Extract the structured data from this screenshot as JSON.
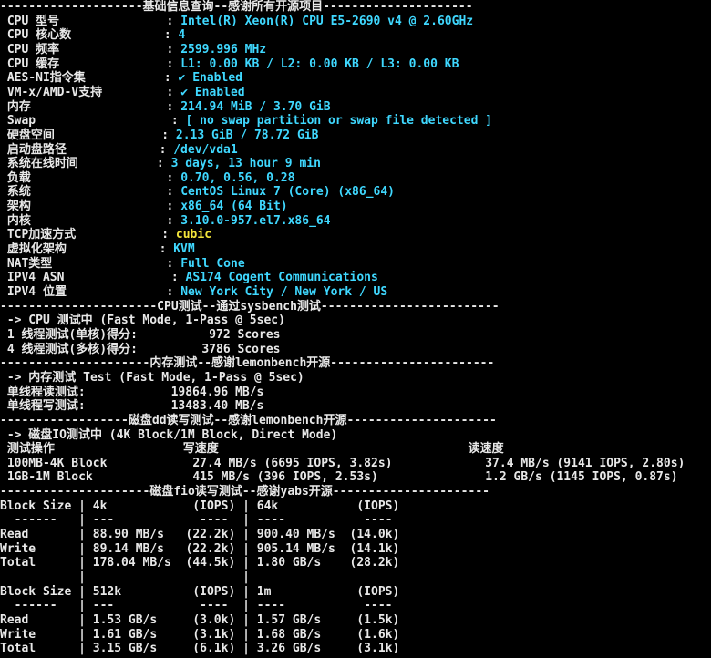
{
  "colors": {
    "background": "#000000",
    "text": "#e8e8e8",
    "value": "#3fd8ff",
    "highlight": "#f2e43a"
  },
  "lines": [
    {
      "segs": [
        {
          "t": "--------------------基础信息查询--感谢所有开源项目---------------------",
          "c": "white"
        }
      ]
    },
    {
      "segs": [
        {
          "t": " CPU 型号",
          "c": "white"
        },
        {
          "t": "               : ",
          "c": "white"
        },
        {
          "t": "Intel(R) Xeon(R) CPU E5-2690 v4 @ 2.60GHz",
          "c": "cyan"
        }
      ]
    },
    {
      "segs": [
        {
          "t": " CPU 核心数",
          "c": "white"
        },
        {
          "t": "             : ",
          "c": "white"
        },
        {
          "t": "4",
          "c": "cyan"
        }
      ]
    },
    {
      "segs": [
        {
          "t": " CPU 频率",
          "c": "white"
        },
        {
          "t": "               : ",
          "c": "white"
        },
        {
          "t": "2599.996 MHz",
          "c": "cyan"
        }
      ]
    },
    {
      "segs": [
        {
          "t": " CPU 缓存",
          "c": "white"
        },
        {
          "t": "               : ",
          "c": "white"
        },
        {
          "t": "L1: 0.00 KB / L2: 0.00 KB / L3: 0.00 KB",
          "c": "cyan"
        }
      ]
    },
    {
      "segs": [
        {
          "t": " AES-NI指令集",
          "c": "white"
        },
        {
          "t": "           : ",
          "c": "white"
        },
        {
          "t": "✔ Enabled",
          "c": "cyan"
        }
      ]
    },
    {
      "segs": [
        {
          "t": " VM-x/AMD-V支持",
          "c": "white"
        },
        {
          "t": "         : ",
          "c": "white"
        },
        {
          "t": "✔ Enabled",
          "c": "cyan"
        }
      ]
    },
    {
      "segs": [
        {
          "t": " 内存",
          "c": "white"
        },
        {
          "t": "                   : ",
          "c": "white"
        },
        {
          "t": "214.94 MiB / 3.70 GiB",
          "c": "cyan"
        }
      ]
    },
    {
      "segs": [
        {
          "t": " Swap",
          "c": "white"
        },
        {
          "t": "                   : ",
          "c": "white"
        },
        {
          "t": "[ no swap partition or swap file detected ]",
          "c": "cyan"
        }
      ]
    },
    {
      "segs": [
        {
          "t": " 硬盘空间",
          "c": "white"
        },
        {
          "t": "               : ",
          "c": "white"
        },
        {
          "t": "2.13 GiB / 78.72 GiB",
          "c": "cyan"
        }
      ]
    },
    {
      "segs": [
        {
          "t": " 启动盘路径",
          "c": "white"
        },
        {
          "t": "             : ",
          "c": "white"
        },
        {
          "t": "/dev/vda1",
          "c": "cyan"
        }
      ]
    },
    {
      "segs": [
        {
          "t": " 系统在线时间",
          "c": "white"
        },
        {
          "t": "           : ",
          "c": "white"
        },
        {
          "t": "3 days, 13 hour 9 min",
          "c": "cyan"
        }
      ]
    },
    {
      "segs": [
        {
          "t": " 负载",
          "c": "white"
        },
        {
          "t": "                   : ",
          "c": "white"
        },
        {
          "t": "0.70, 0.56, 0.28",
          "c": "cyan"
        }
      ]
    },
    {
      "segs": [
        {
          "t": " 系统",
          "c": "white"
        },
        {
          "t": "                   : ",
          "c": "white"
        },
        {
          "t": "CentOS Linux 7 (Core) (x86_64)",
          "c": "cyan"
        }
      ]
    },
    {
      "segs": [
        {
          "t": " 架构",
          "c": "white"
        },
        {
          "t": "                   : ",
          "c": "white"
        },
        {
          "t": "x86_64 (64 Bit)",
          "c": "cyan"
        }
      ]
    },
    {
      "segs": [
        {
          "t": " 内核",
          "c": "white"
        },
        {
          "t": "                   : ",
          "c": "white"
        },
        {
          "t": "3.10.0-957.el7.x86_64",
          "c": "cyan"
        }
      ]
    },
    {
      "segs": [
        {
          "t": " TCP加速方式",
          "c": "white"
        },
        {
          "t": "            : ",
          "c": "white"
        },
        {
          "t": "cubic",
          "c": "yellow"
        }
      ]
    },
    {
      "segs": [
        {
          "t": " 虚拟化架构",
          "c": "white"
        },
        {
          "t": "             : ",
          "c": "white"
        },
        {
          "t": "KVM",
          "c": "cyan"
        }
      ]
    },
    {
      "segs": [
        {
          "t": " NAT类型",
          "c": "white"
        },
        {
          "t": "                : ",
          "c": "white"
        },
        {
          "t": "Full Cone",
          "c": "cyan"
        }
      ]
    },
    {
      "segs": [
        {
          "t": " IPV4 ASN",
          "c": "white"
        },
        {
          "t": "               : ",
          "c": "white"
        },
        {
          "t": "AS174 Cogent Communications",
          "c": "cyan"
        }
      ]
    },
    {
      "segs": [
        {
          "t": " IPV4 位置",
          "c": "white"
        },
        {
          "t": "              : ",
          "c": "white"
        },
        {
          "t": "New York City / New York / US",
          "c": "cyan"
        }
      ]
    },
    {
      "segs": [
        {
          "t": "----------------------CPU测试--通过sysbench测试-------------------------",
          "c": "white"
        }
      ]
    },
    {
      "segs": [
        {
          "t": " -> CPU 测试中 (Fast Mode, 1-Pass @ 5sec)",
          "c": "white"
        }
      ]
    },
    {
      "segs": [
        {
          "t": " 1 线程测试(单核)得分:          972 Scores",
          "c": "white"
        }
      ]
    },
    {
      "segs": [
        {
          "t": " 4 线程测试(多核)得分:         3786 Scores",
          "c": "white"
        }
      ]
    },
    {
      "segs": [
        {
          "t": "---------------------内存测试--感谢lemonbench开源-----------------------",
          "c": "white"
        }
      ]
    },
    {
      "segs": [
        {
          "t": " -> 内存测试 Test (Fast Mode, 1-Pass @ 5sec)",
          "c": "white"
        }
      ]
    },
    {
      "segs": [
        {
          "t": " 单线程读测试:            19864.96 MB/s",
          "c": "white"
        }
      ]
    },
    {
      "segs": [
        {
          "t": " 单线程写测试:            13483.40 MB/s",
          "c": "white"
        }
      ]
    },
    {
      "segs": [
        {
          "t": "------------------磁盘dd读写测试--感谢lemonbench开源---------------------",
          "c": "white"
        }
      ]
    },
    {
      "segs": [
        {
          "t": " -> 磁盘IO测试中 (4K Block/1M Block, Direct Mode)",
          "c": "white"
        }
      ]
    },
    {
      "segs": [
        {
          "t": " 测试操作                  写速度                                   读速度",
          "c": "white"
        }
      ]
    },
    {
      "segs": [
        {
          "t": " 100MB-4K Block            27.4 MB/s (6695 IOPS, 3.82s)             37.4 MB/s (9141 IOPS, 2.80s)",
          "c": "white"
        }
      ]
    },
    {
      "segs": [
        {
          "t": " 1GB-1M Block              415 MB/s (396 IOPS, 2.53s)               1.2 GB/s (1145 IOPS, 0.87s)",
          "c": "white"
        }
      ]
    },
    {
      "segs": [
        {
          "t": "---------------------磁盘fio读写测试--感谢yabs开源----------------------",
          "c": "white"
        }
      ]
    },
    {
      "segs": [
        {
          "t": "Block Size | 4k            (IOPS) | 64k           (IOPS)",
          "c": "white"
        }
      ]
    },
    {
      "segs": [
        {
          "t": "  ------   | ---            ----  | ----           ----",
          "c": "white"
        }
      ]
    },
    {
      "segs": [
        {
          "t": "Read       | 88.90 MB/s   (22.2k) | 900.40 MB/s  (14.0k)",
          "c": "white"
        }
      ]
    },
    {
      "segs": [
        {
          "t": "Write      | 89.14 MB/s   (22.2k) | 905.14 MB/s  (14.1k)",
          "c": "white"
        }
      ]
    },
    {
      "segs": [
        {
          "t": "Total      | 178.04 MB/s  (44.5k) | 1.80 GB/s    (28.2k)",
          "c": "white"
        }
      ]
    },
    {
      "segs": [
        {
          "t": "           |                      |",
          "c": "white"
        }
      ]
    },
    {
      "segs": [
        {
          "t": "Block Size | 512k          (IOPS) | 1m            (IOPS)",
          "c": "white"
        }
      ]
    },
    {
      "segs": [
        {
          "t": "  ------   | ---            ----  | ----           ----",
          "c": "white"
        }
      ]
    },
    {
      "segs": [
        {
          "t": "Read       | 1.53 GB/s     (3.0k) | 1.57 GB/s     (1.5k)",
          "c": "white"
        }
      ]
    },
    {
      "segs": [
        {
          "t": "Write      | 1.61 GB/s     (3.1k) | 1.68 GB/s     (1.6k)",
          "c": "white"
        }
      ]
    },
    {
      "segs": [
        {
          "t": "Total      | 3.15 GB/s     (6.1k) | 3.26 GB/s     (3.1k)",
          "c": "white"
        }
      ]
    }
  ]
}
